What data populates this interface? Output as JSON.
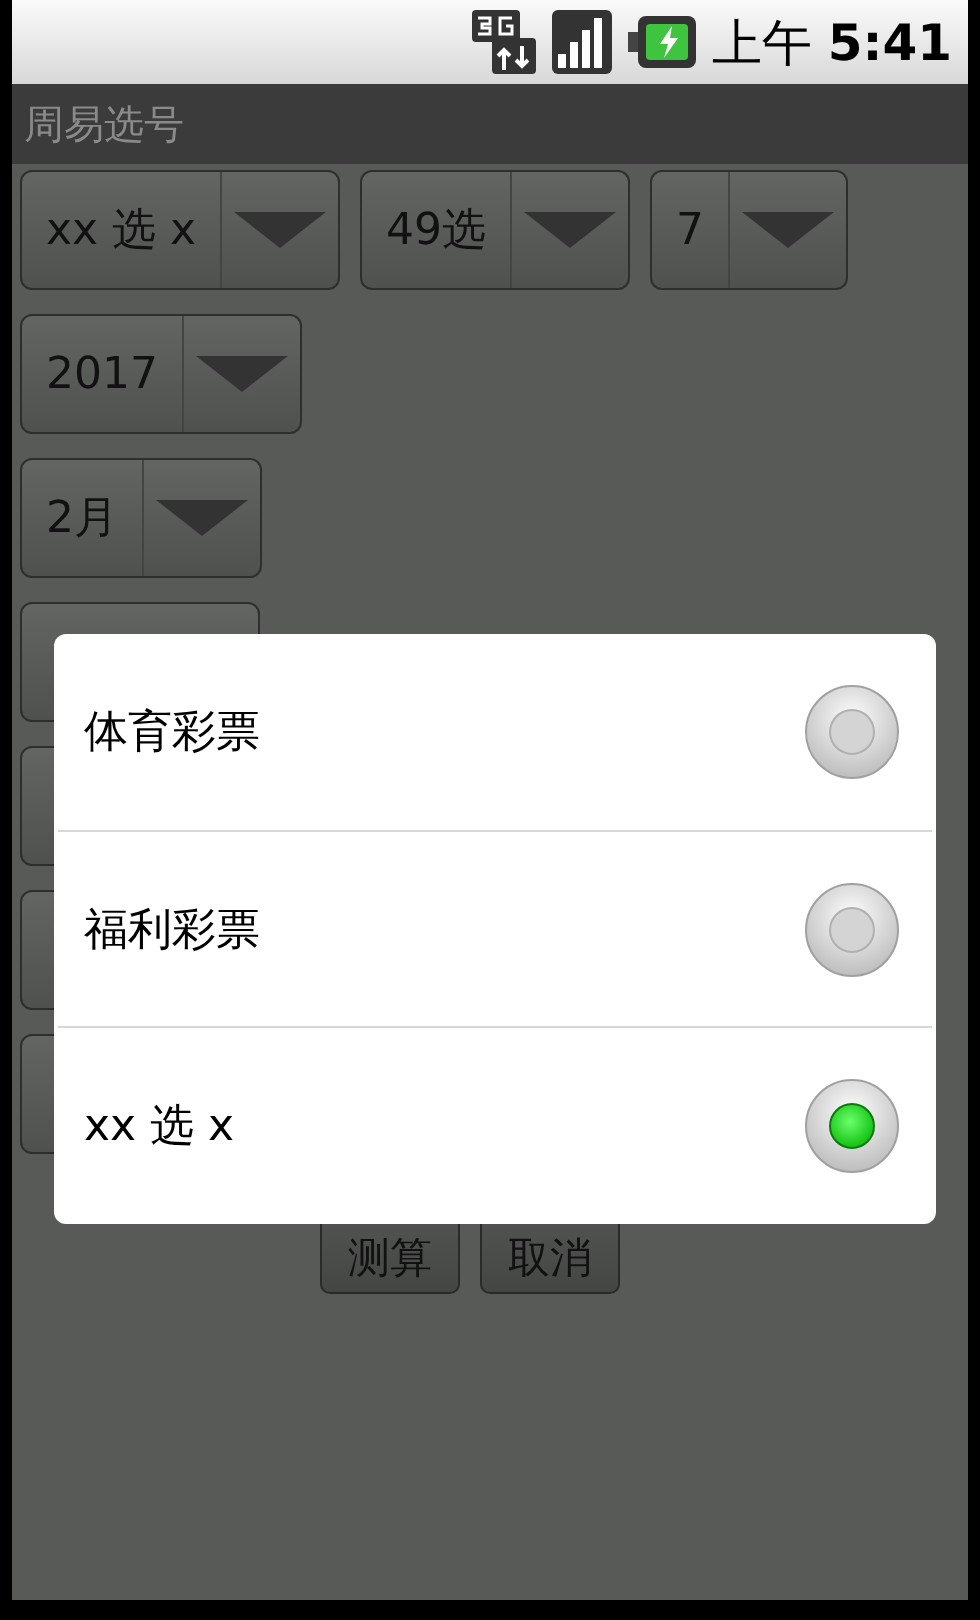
{
  "status_bar": {
    "period": "上午",
    "time": "5:41"
  },
  "title": "周易选号",
  "spinner_rows": [
    [
      {
        "kind": "shown",
        "value": "xx 选 x"
      },
      {
        "kind": "shown",
        "value": "49选"
      },
      {
        "kind": "shown",
        "value": "7"
      }
    ],
    [
      {
        "kind": "shown",
        "value": "2017"
      }
    ],
    [
      {
        "kind": "shown",
        "value": "2月"
      }
    ],
    [
      {
        "kind": "covered"
      }
    ],
    [
      {
        "kind": "covered"
      }
    ],
    [
      {
        "kind": "covered"
      }
    ],
    [
      {
        "kind": "covered"
      }
    ]
  ],
  "buttons": [
    "测算",
    "取消"
  ],
  "dialog": {
    "options": [
      {
        "label": "体育彩票",
        "selected": false
      },
      {
        "label": "福利彩票",
        "selected": false
      },
      {
        "label": "xx 选 x",
        "selected": true
      }
    ]
  }
}
